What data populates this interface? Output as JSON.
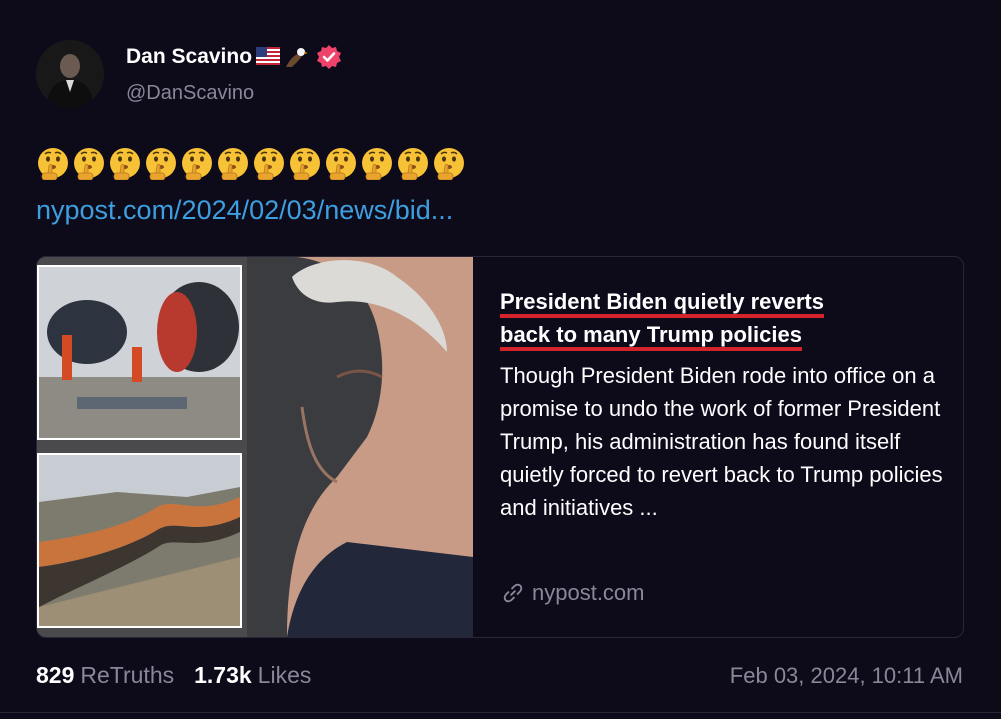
{
  "author": {
    "display_name": "Dan Scavino",
    "name_emojis": [
      "us-flag-icon",
      "eagle-icon"
    ],
    "verified": true,
    "handle": "@DanScavino"
  },
  "post": {
    "emoji_text": "🤫🤫🤫🤫🤫🤫🤫🤫🤫🤫🤫🤫",
    "emoji_count": 12,
    "link_text": "nypost.com/2024/02/03/news/bid..."
  },
  "card": {
    "title_line1": "President Biden quietly reverts",
    "title_line2": "back to many Trump policies",
    "description": "Though President Biden rode into office on a promise to undo the work of former President Trump, his administration has found itself quietly forced to revert back to Trump policies and initiatives ...",
    "source": "nypost.com"
  },
  "stats": {
    "retruths_count": "829",
    "retruths_label": "ReTruths",
    "likes_count": "1.73k",
    "likes_label": "Likes"
  },
  "timestamp": "Feb 03, 2024, 10:11 AM",
  "colors": {
    "background": "#0d0a1a",
    "link": "#3d9fe0",
    "muted": "#8a8799",
    "verified_badge": "#f0436b",
    "underline": "#d5232b"
  }
}
